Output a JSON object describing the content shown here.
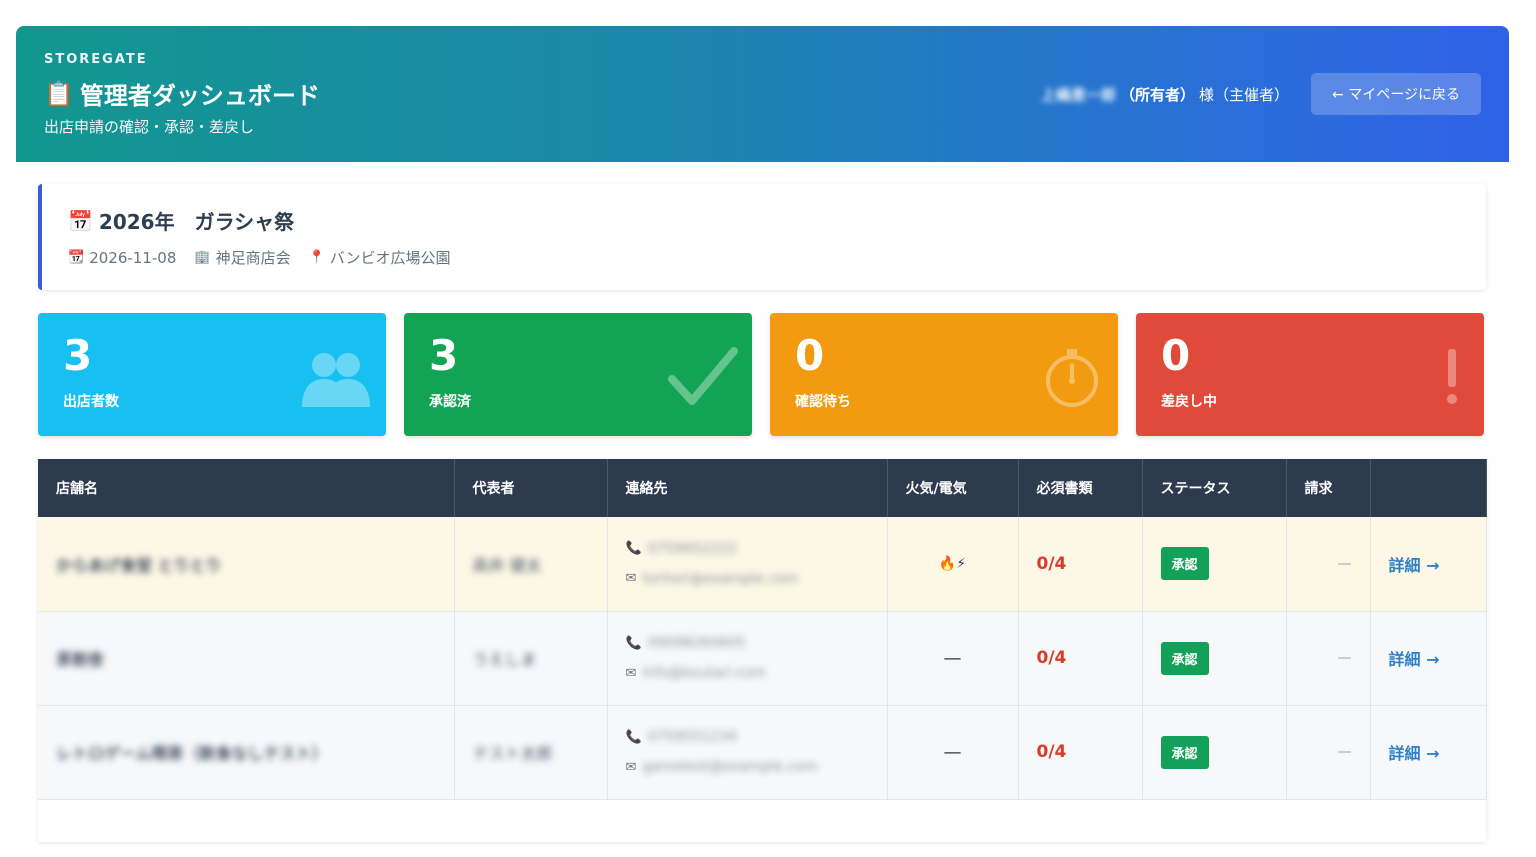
{
  "header": {
    "brand": "STOREGATE",
    "title_icon": "📋",
    "title": "管理者ダッシュボード",
    "subtitle": "出店申請の確認・承認・差戻し",
    "user_name": "上嶋恵一郎",
    "user_role": "（所有者）",
    "user_suffix": "様（主催者）",
    "back_button": "← マイページに戻る"
  },
  "event": {
    "icon": "📅",
    "title": "2026年　ガラシャ祭",
    "date_icon": "📆",
    "date": "2026-11-08",
    "org_icon": "🏢",
    "organizer": "神足商店会",
    "venue_icon": "📍",
    "venue": "バンビオ広場公園"
  },
  "stats": [
    {
      "value": "3",
      "label": "出店者数",
      "color": "#17c0f0",
      "icon": "users-icon"
    },
    {
      "value": "3",
      "label": "承認済",
      "color": "#12a354",
      "icon": "check-icon"
    },
    {
      "value": "0",
      "label": "確認待ち",
      "color": "#f29b11",
      "icon": "stopwatch-icon"
    },
    {
      "value": "0",
      "label": "差戻し中",
      "color": "#e04a3a",
      "icon": "exclamation-icon"
    }
  ],
  "table": {
    "headers": [
      "店舗名",
      "代表者",
      "連絡先",
      "火気/電気",
      "必須書類",
      "ステータス",
      "請求",
      ""
    ],
    "rows": [
      {
        "shop": "からあげ食堂 とりとり",
        "rep": "高井 健太",
        "phone": "0759652222",
        "email": "toritori@example.com",
        "fire": "🔥⚡",
        "docs": "0/4",
        "status": "承認",
        "bill": "—",
        "detail": "詳細 →"
      },
      {
        "shop": "茶割舎",
        "rep": "うえしま",
        "phone": "09098260605",
        "email": "info@koutari.com",
        "fire": "—",
        "docs": "0/4",
        "status": "承認",
        "bill": "—",
        "detail": "詳細 →"
      },
      {
        "shop": "レトロゲーム喫茶（飲食なしテスト）",
        "rep": "テスト太郎",
        "phone": "0759551234",
        "email": "gametest@example.com",
        "fire": "—",
        "docs": "0/4",
        "status": "承認",
        "bill": "—",
        "detail": "詳細 →"
      }
    ]
  }
}
